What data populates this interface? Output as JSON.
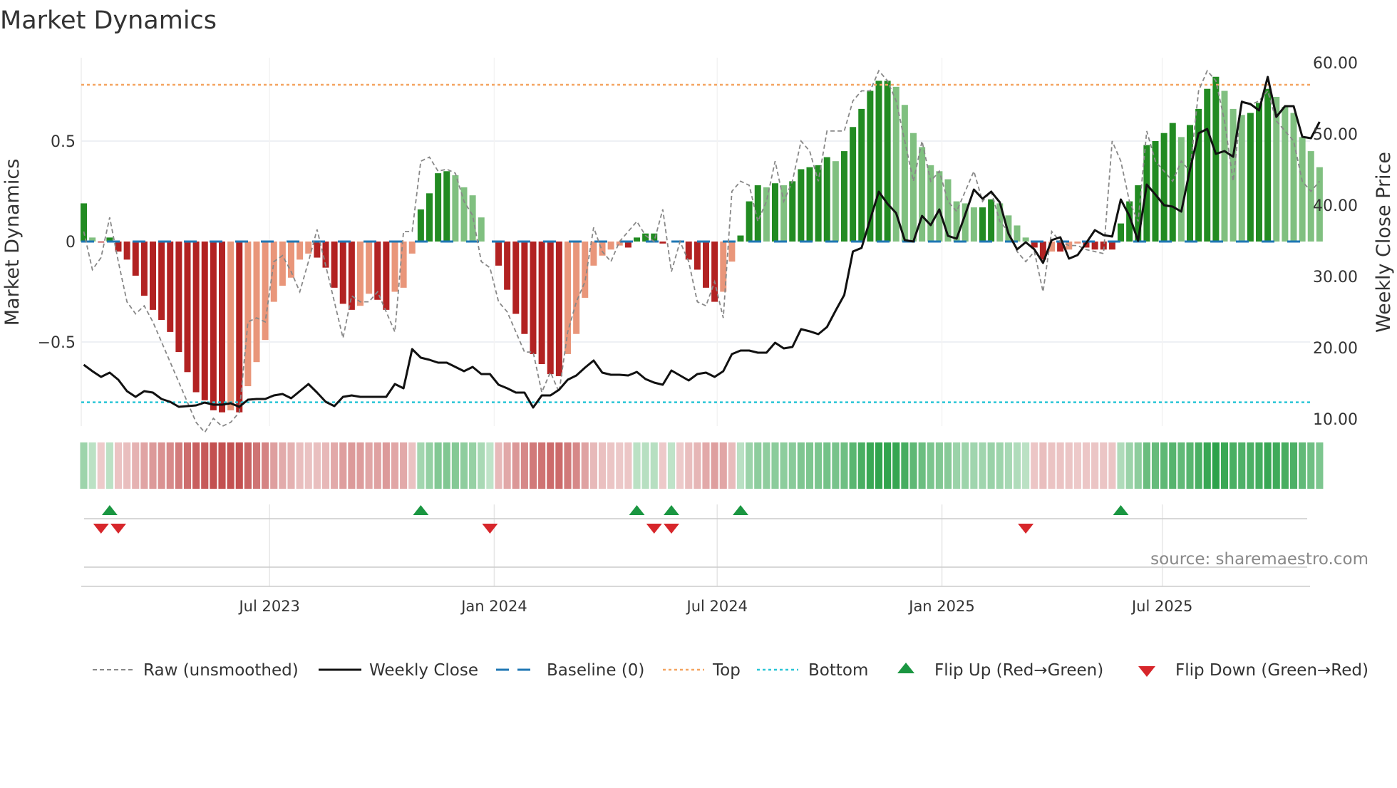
{
  "chart_data": {
    "type": "bar",
    "title": "Market Dynamics",
    "ylabel_left": "Market Dynamics",
    "ylabel_right": "Weekly Close Price",
    "ylim_left": [
      -0.88,
      0.92
    ],
    "ylim_right": [
      10,
      60
    ],
    "left_ticks": [
      {
        "value": 0.5,
        "label": "0.5"
      },
      {
        "value": 0,
        "label": "0"
      },
      {
        "value": -0.5,
        "label": "−0.5"
      }
    ],
    "right_ticks": [
      {
        "value": 60,
        "label": "60.00"
      },
      {
        "value": 50,
        "label": "50.00"
      },
      {
        "value": 40,
        "label": "40.00"
      },
      {
        "value": 30,
        "label": "30.00"
      },
      {
        "value": 20,
        "label": "20.00"
      },
      {
        "value": 10,
        "label": "10.00"
      }
    ],
    "x_unit": "week index",
    "x_ticks": [
      {
        "week": 21.5,
        "label": "Jul 2023"
      },
      {
        "week": 47.5,
        "label": "Jan 2024"
      },
      {
        "week": 73.3,
        "label": "Jul 2024"
      },
      {
        "week": 99.3,
        "label": "Jan 2025"
      },
      {
        "week": 124.8,
        "label": "Jul 2025"
      }
    ],
    "top_level": 0.78,
    "bottom_level": -0.8,
    "momentum": [
      0.19,
      0.02,
      -0.005,
      0.02,
      -0.05,
      -0.09,
      -0.17,
      -0.27,
      -0.34,
      -0.39,
      -0.45,
      -0.55,
      -0.65,
      -0.75,
      -0.79,
      -0.84,
      -0.85,
      -0.84,
      -0.85,
      -0.72,
      -0.6,
      -0.49,
      -0.3,
      -0.22,
      -0.18,
      -0.09,
      -0.06,
      -0.08,
      -0.13,
      -0.23,
      -0.31,
      -0.34,
      -0.32,
      -0.26,
      -0.29,
      -0.34,
      -0.25,
      -0.23,
      -0.06,
      0.16,
      0.24,
      0.34,
      0.35,
      0.33,
      0.27,
      0.23,
      0.12,
      0.0,
      -0.12,
      -0.24,
      -0.36,
      -0.46,
      -0.56,
      -0.61,
      -0.66,
      -0.67,
      -0.56,
      -0.46,
      -0.28,
      -0.12,
      -0.07,
      -0.04,
      -0.02,
      -0.03,
      0.02,
      0.04,
      0.04,
      -0.01,
      0.0,
      -0.005,
      -0.09,
      -0.14,
      -0.23,
      -0.3,
      -0.25,
      -0.1,
      0.03,
      0.2,
      0.28,
      0.27,
      0.29,
      0.28,
      0.3,
      0.36,
      0.37,
      0.38,
      0.42,
      0.4,
      0.45,
      0.57,
      0.66,
      0.75,
      0.8,
      0.8,
      0.77,
      0.68,
      0.54,
      0.47,
      0.38,
      0.35,
      0.31,
      0.2,
      0.19,
      0.17,
      0.17,
      0.21,
      0.19,
      0.13,
      0.08,
      0.02,
      -0.03,
      -0.09,
      -0.05,
      -0.05,
      -0.04,
      -0.01,
      -0.03,
      -0.04,
      -0.04,
      -0.04,
      0.09,
      0.2,
      0.28,
      0.48,
      0.5,
      0.54,
      0.59,
      0.52,
      0.58,
      0.66,
      0.76,
      0.82,
      0.75,
      0.66,
      0.63,
      0.64,
      0.69,
      0.76,
      0.72,
      0.67,
      0.64,
      0.52,
      0.45,
      0.37
    ],
    "raw": [
      0.05,
      -0.14,
      -0.08,
      0.12,
      -0.1,
      -0.3,
      -0.36,
      -0.32,
      -0.4,
      -0.5,
      -0.6,
      -0.7,
      -0.8,
      -0.9,
      -0.95,
      -0.88,
      -0.92,
      -0.9,
      -0.85,
      -0.4,
      -0.38,
      -0.4,
      -0.1,
      -0.07,
      -0.15,
      -0.25,
      -0.1,
      0.06,
      -0.12,
      -0.3,
      -0.48,
      -0.27,
      -0.3,
      -0.3,
      -0.25,
      -0.35,
      -0.45,
      0.05,
      0.05,
      0.4,
      0.42,
      0.35,
      0.36,
      0.34,
      0.2,
      0.13,
      -0.1,
      -0.13,
      -0.3,
      -0.35,
      -0.45,
      -0.55,
      -0.55,
      -0.75,
      -0.65,
      -0.75,
      -0.45,
      -0.3,
      -0.2,
      0.07,
      -0.05,
      -0.1,
      0.0,
      0.05,
      0.1,
      0.03,
      0.0,
      0.16,
      -0.15,
      0.0,
      -0.1,
      -0.3,
      -0.32,
      -0.2,
      -0.38,
      0.25,
      0.3,
      0.28,
      0.1,
      0.2,
      0.4,
      0.2,
      0.3,
      0.5,
      0.45,
      0.3,
      0.55,
      0.55,
      0.55,
      0.7,
      0.75,
      0.75,
      0.85,
      0.8,
      0.7,
      0.5,
      0.3,
      0.5,
      0.3,
      0.35,
      0.2,
      0.15,
      0.25,
      0.35,
      0.2,
      0.25,
      0.1,
      0.05,
      -0.05,
      -0.1,
      -0.05,
      -0.25,
      0.05,
      0.0,
      -0.02,
      -0.02,
      -0.04,
      -0.05,
      -0.06,
      0.5,
      0.4,
      0.2,
      0.1,
      0.55,
      0.4,
      0.35,
      0.3,
      0.4,
      0.35,
      0.75,
      0.85,
      0.8,
      0.6,
      0.3,
      0.7,
      0.68,
      0.7,
      0.75,
      0.6,
      0.55,
      0.5,
      0.3,
      0.25,
      0.3
    ],
    "close": [
      17.6,
      16.7,
      15.9,
      16.5,
      15.5,
      13.9,
      13.1,
      13.9,
      13.7,
      12.8,
      12.4,
      11.7,
      11.8,
      11.9,
      12.3,
      12.0,
      12.0,
      12.2,
      11.7,
      12.7,
      12.8,
      12.8,
      13.3,
      13.5,
      12.9,
      13.9,
      14.9,
      13.7,
      12.4,
      11.8,
      13.1,
      13.3,
      13.1,
      13.1,
      13.1,
      13.1,
      14.9,
      14.3,
      19.8,
      18.6,
      18.3,
      17.9,
      17.9,
      17.3,
      16.7,
      17.3,
      16.3,
      16.3,
      14.8,
      14.3,
      13.7,
      13.7,
      11.6,
      13.3,
      13.3,
      14.1,
      15.5,
      16.1,
      17.2,
      18.2,
      16.5,
      16.2,
      16.2,
      16.1,
      16.6,
      15.6,
      15.1,
      14.8,
      16.8,
      16.1,
      15.4,
      16.3,
      16.5,
      15.9,
      16.7,
      19.1,
      19.6,
      19.6,
      19.3,
      19.3,
      20.7,
      19.9,
      20.1,
      22.6,
      22.3,
      21.9,
      22.9,
      25.2,
      27.4,
      33.5,
      34.0,
      38.0,
      41.9,
      40.2,
      38.9,
      35.1,
      34.9,
      38.5,
      37.2,
      39.4,
      35.7,
      35.3,
      38.7,
      42.2,
      40.9,
      41.9,
      40.4,
      36.0,
      33.8,
      34.8,
      33.8,
      31.9,
      35.1,
      35.5,
      32.5,
      33.0,
      34.7,
      36.5,
      35.8,
      35.6,
      40.8,
      38.5,
      35.0,
      42.9,
      41.5,
      40.0,
      39.8,
      39.1,
      45.0,
      50.1,
      50.7,
      47.2,
      47.6,
      46.8,
      54.5,
      54.2,
      53.3,
      58.0,
      52.4,
      53.9,
      53.9,
      49.6,
      49.4,
      51.7
    ],
    "flip_up_weeks": [
      3,
      39,
      64,
      68,
      76,
      120
    ],
    "flip_down_weeks": [
      2,
      4,
      47,
      66,
      68,
      109
    ],
    "legend": {
      "placement": "bottom",
      "raw": "Raw (unsmoothed)",
      "close": "Weekly Close",
      "baseline": "Baseline (0)",
      "top": "Top",
      "bottom": "Bottom",
      "flip_up": "Flip Up (Red→Green)",
      "flip_down": "Flip Down (Green→Red)"
    },
    "source": "source: sharemaestro.com",
    "colors": {
      "pos_strong": "#228b22",
      "pos_weak": "#80c080",
      "neg_strong": "#b22222",
      "neg_weak": "#e9967a",
      "close": "#111111",
      "raw": "#888888",
      "baseline": "#1f77b4",
      "top": "#f4a460",
      "bottom": "#29c5d6",
      "flip_up": "#1a9641",
      "flip_down": "#d7262b"
    }
  }
}
